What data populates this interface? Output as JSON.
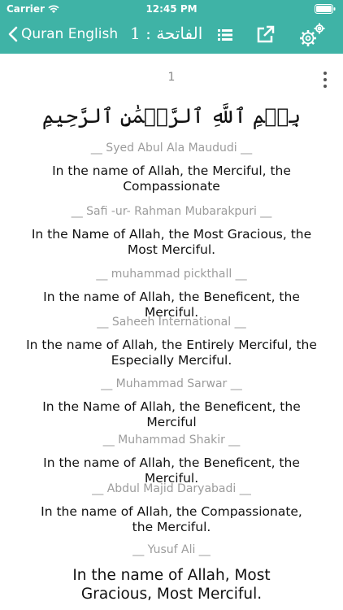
{
  "status": {
    "carrier": "Carrier",
    "time": "12:45 PM"
  },
  "nav": {
    "back_label": "Quran English",
    "title": "الفاتحة : 1",
    "icons": [
      "chevron-left-icon",
      "list-icon",
      "share-icon",
      "settings-icon"
    ]
  },
  "ayah": {
    "number": "1",
    "arabic": "بِسۡمِ ٱللَّهِ ٱلرَّحۡمَٰنِ ٱلرَّحِيمِ"
  },
  "translations": [
    {
      "name": "__ Syed Abul Ala Maududi __",
      "text": "In the name of Allah, the Merciful, the Compassionate"
    },
    {
      "name": "__ Safi -ur- Rahman Mubarakpuri __",
      "text": "In the Name of Allah, the Most Gracious, the Most Merciful."
    },
    {
      "name": "__ muhammad pickthall __",
      "text": "In the name of Allah, the Beneficent, the Merciful."
    },
    {
      "name": "__ Saheeh International __",
      "text": "In the name of Allah, the Entirely Merciful, the Especially Merciful."
    },
    {
      "name": "__ Muhammad Sarwar __",
      "text": "In the Name of Allah, the Beneficent, the Merciful"
    },
    {
      "name": "__ Muhammad Shakir __",
      "text": "In the name of Allah, the Beneficent, the Merciful."
    },
    {
      "name": "__ Abdul Majid Daryabadi __",
      "text": "In the name of Allah, the Compassionate, the Merciful."
    },
    {
      "name": "__ Yusuf Ali __",
      "text": "In the name of Allah, Most Gracious, Most Merciful."
    }
  ],
  "colors": {
    "accent": "#3fb3a6"
  }
}
